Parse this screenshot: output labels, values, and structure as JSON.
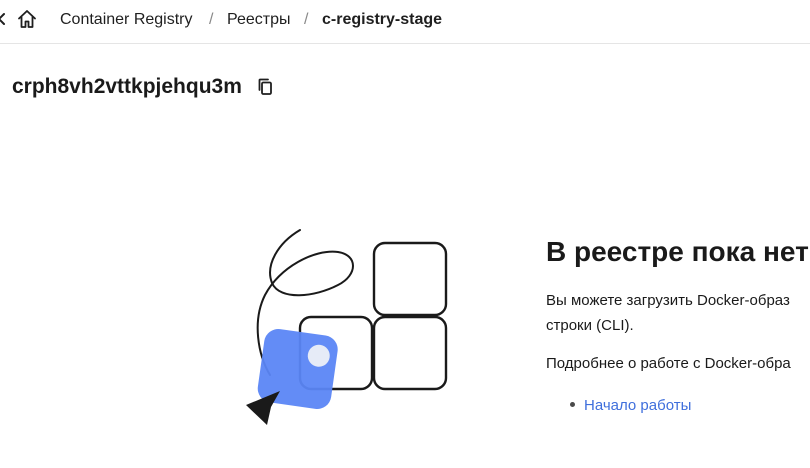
{
  "breadcrumb": {
    "items": [
      "Container Registry",
      "Реестры"
    ],
    "current": "c-registry-stage",
    "separator": "/"
  },
  "registry": {
    "id": "crph8vh2vttkpjehqu3m"
  },
  "empty_state": {
    "title": "В реестре пока нет",
    "description": "Вы можете загрузить Docker-образ строки (CLI).",
    "description_line1": "Вы можете загрузить Docker-образ",
    "description_line2": "строки (CLI).",
    "more_info": "Подробнее о работе с Docker-обра",
    "link": "Начало работы"
  },
  "icons": {
    "home": "home-icon",
    "copy": "copy-icon",
    "back": "chevron-left-icon"
  },
  "colors": {
    "accent_blue": "#5b86f5",
    "link": "#3f6fdc",
    "text": "#1a1a1a"
  }
}
